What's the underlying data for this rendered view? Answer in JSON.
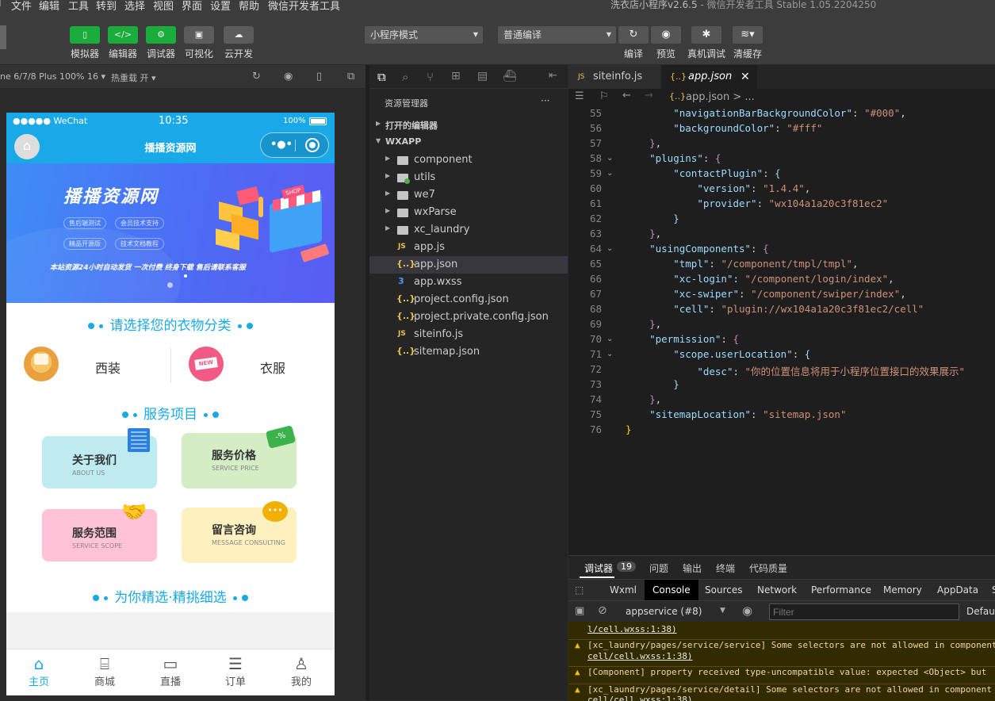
{
  "menubar": {
    "items": [
      "文件",
      "编辑",
      "工具",
      "转到",
      "选择",
      "视图",
      "界面",
      "设置",
      "帮助",
      "微信开发者工具"
    ],
    "window_title": "洗衣店小程序v2.6.5",
    "window_subtitle": " - 微信开发者工具 Stable 1.05.2204250"
  },
  "toolbar": {
    "left_buttons": [
      {
        "label": "模拟器",
        "icon": "phone-icon"
      },
      {
        "label": "编辑器",
        "icon": "code-icon"
      },
      {
        "label": "调试器",
        "icon": "debug-icon"
      },
      {
        "label": "可视化",
        "icon": "layout-icon"
      },
      {
        "label": "云开发",
        "icon": "cloud-icon"
      }
    ],
    "mode_select": "小程序模式",
    "compile_select": "普通编译",
    "right_buttons": [
      {
        "label": "编译",
        "icon": "refresh-icon"
      },
      {
        "label": "预览",
        "icon": "eye-icon"
      },
      {
        "label": "真机调试",
        "icon": "bug-icon"
      },
      {
        "label": "清缓存",
        "icon": "layers-icon"
      }
    ]
  },
  "simulator": {
    "device_label": "ne 6/7/8 Plus 100% 16 ▾",
    "hot_reload": "热重载 开 ▾"
  },
  "phone": {
    "status_carrier": "●●●●● WeChat",
    "status_time": "10:35",
    "status_battery": "100%",
    "nav_title": "播播资源网",
    "banner_title": "播播资源网",
    "banner_tags": [
      "售后端测试",
      "会员技术支持",
      "精品开源版",
      "技术文档教程"
    ],
    "banner_slogan": "本站资源24小时自动发货 一次付费 终身下载 售后请联系客服",
    "section1_title": "请选择您的衣物分类",
    "categories": [
      "西装",
      "衣服"
    ],
    "section2_title": "服务项目",
    "services": [
      {
        "title": "关于我们",
        "subtitle": "ABOUT US",
        "color": "#bdebf0"
      },
      {
        "title": "服务价格",
        "subtitle": "SERVICE PRICE",
        "color": "#d5edc4"
      },
      {
        "title": "服务范围",
        "subtitle": "SERVICE SCOPE",
        "color": "#ffc2d6"
      },
      {
        "title": "留言咨询",
        "subtitle": "MESSAGE CONSULTING",
        "color": "#fff0bf"
      }
    ],
    "section3_title": "为你精选·精挑细选",
    "tabs": [
      {
        "label": "主页",
        "icon": "home-icon",
        "active": true
      },
      {
        "label": "商城",
        "icon": "store-icon",
        "active": false
      },
      {
        "label": "直播",
        "icon": "video-icon",
        "active": false
      },
      {
        "label": "订单",
        "icon": "order-icon",
        "active": false
      },
      {
        "label": "我的",
        "icon": "user-icon",
        "active": false
      }
    ]
  },
  "explorer": {
    "title": "资源管理器",
    "more": "···",
    "open_editors": "打开的编辑器",
    "root": "WXAPP",
    "folders": [
      "component",
      "utils",
      "we7",
      "wxParse",
      "xc_laundry"
    ],
    "files": [
      {
        "name": "app.js",
        "type": "js"
      },
      {
        "name": "app.json",
        "type": "json"
      },
      {
        "name": "app.wxss",
        "type": "wxss"
      },
      {
        "name": "project.config.json",
        "type": "json"
      },
      {
        "name": "project.private.config.json",
        "type": "json"
      },
      {
        "name": "siteinfo.js",
        "type": "js"
      },
      {
        "name": "sitemap.json",
        "type": "json"
      }
    ]
  },
  "editor": {
    "tabs": [
      "siteinfo.js",
      "app.json"
    ],
    "breadcrumb": "app.json > ...",
    "lines": [
      {
        "n": "55",
        "k": "\"navigationBarBackgroundColor\"",
        "v": "\"#000\"",
        "indent": 2,
        "tail": ","
      },
      {
        "n": "56",
        "k": "\"backgroundColor\"",
        "v": "\"#fff\"",
        "indent": 2,
        "tail": ""
      },
      {
        "n": "57",
        "raw": "},",
        "indent": 1
      },
      {
        "n": "58",
        "k": "\"plugins\"",
        "open": "{",
        "indent": 1
      },
      {
        "n": "59",
        "k": "\"contactPlugin\"",
        "open": "{",
        "indent": 2
      },
      {
        "n": "60",
        "k": "\"version\"",
        "v": "\"1.4.4\"",
        "indent": 3,
        "tail": ","
      },
      {
        "n": "61",
        "k": "\"provider\"",
        "v": "\"wx104a1a20c3f81ec2\"",
        "indent": 3,
        "tail": ""
      },
      {
        "n": "62",
        "raw": "}",
        "indent": 2
      },
      {
        "n": "63",
        "raw": "},",
        "indent": 1
      },
      {
        "n": "64",
        "k": "\"usingComponents\"",
        "open": "{",
        "indent": 1
      },
      {
        "n": "65",
        "k": "\"tmpl\"",
        "v": "\"/component/tmpl/tmpl\"",
        "indent": 2,
        "tail": ","
      },
      {
        "n": "66",
        "k": "\"xc-login\"",
        "v": "\"/component/login/index\"",
        "indent": 2,
        "tail": ","
      },
      {
        "n": "67",
        "k": "\"xc-swiper\"",
        "v": "\"/component/swiper/index\"",
        "indent": 2,
        "tail": ","
      },
      {
        "n": "68",
        "k": "\"cell\"",
        "v": "\"plugin://wx104a1a20c3f81ec2/cell\"",
        "indent": 2,
        "tail": ""
      },
      {
        "n": "69",
        "raw": "},",
        "indent": 1
      },
      {
        "n": "70",
        "k": "\"permission\"",
        "open": "{",
        "indent": 1
      },
      {
        "n": "71",
        "k": "\"scope.userLocation\"",
        "open": "{",
        "indent": 2
      },
      {
        "n": "72",
        "k": "\"desc\"",
        "v": "\"你的位置信息将用于小程序位置接口的效果展示\"",
        "indent": 3,
        "tail": ""
      },
      {
        "n": "73",
        "raw": "}",
        "indent": 2
      },
      {
        "n": "74",
        "raw": "},",
        "indent": 1
      },
      {
        "n": "75",
        "k": "\"sitemapLocation\"",
        "v": "\"sitemap.json\"",
        "indent": 1,
        "tail": ""
      },
      {
        "n": "76",
        "raw": "}",
        "indent": 0
      }
    ]
  },
  "devtools": {
    "tabs": [
      "调试器",
      "19",
      "问题",
      "输出",
      "终端",
      "代码质量"
    ],
    "chrome_tabs": [
      "Wxml",
      "Console",
      "Sources",
      "Network",
      "Performance",
      "Memory",
      "AppData",
      "S"
    ],
    "context": "appservice (#8)",
    "filter_placeholder": "Filter",
    "level": "Default",
    "console_lines": [
      {
        "text": "l/cell.wxss:1:38)",
        "warn": false,
        "link": true
      },
      {
        "text": "[xc_laundry/pages/service/service] Some selectors are not allowed in component",
        "warn": true
      },
      {
        "text": "cell/cell.wxss:1:38)",
        "warn": false,
        "link": true
      },
      {
        "text": "[Component] property received type-uncompatible value: expected <Object> but",
        "warn": true
      },
      {
        "text": "[xc_laundry/pages/service/detail] Some selectors are not allowed in component",
        "warn": true
      },
      {
        "text": "cell/cell.wxss:1:38)",
        "warn": false,
        "link": true
      }
    ]
  }
}
